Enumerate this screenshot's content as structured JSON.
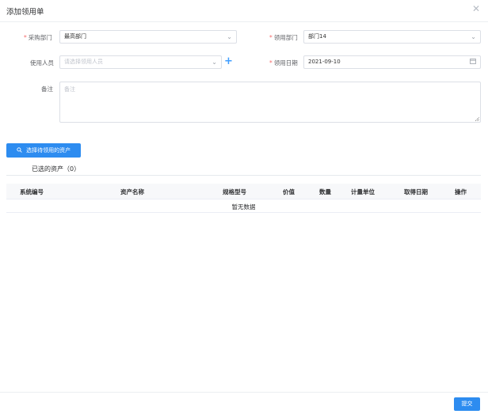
{
  "dialog": {
    "title": "添加领用单",
    "close_icon": "close-icon"
  },
  "form": {
    "purchase_dept": {
      "label": "采购部门",
      "value": "最高部门"
    },
    "receive_dept": {
      "label": "领用部门",
      "value": "部门14"
    },
    "user": {
      "label": "使用人员",
      "placeholder": "请选择领用人员"
    },
    "receive_date": {
      "label": "领用日期",
      "value": "2021-09-10"
    },
    "remark": {
      "label": "备注",
      "placeholder": "备注"
    },
    "required_mark": "*"
  },
  "select_assets_button": {
    "label": "选择待领用的资产",
    "icon": "search-icon"
  },
  "selected_tab": {
    "label": "已选的资产（0）"
  },
  "table": {
    "columns": [
      "系统编号",
      "资产名称",
      "规格型号",
      "价值",
      "数量",
      "计量单位",
      "取得日期",
      "操作"
    ],
    "empty_text": "暂无数据"
  },
  "submit_button": {
    "label": "提交"
  },
  "colors": {
    "primary": "#2d8cf0",
    "required": "#f56c6c",
    "border": "#dcdfe6"
  }
}
